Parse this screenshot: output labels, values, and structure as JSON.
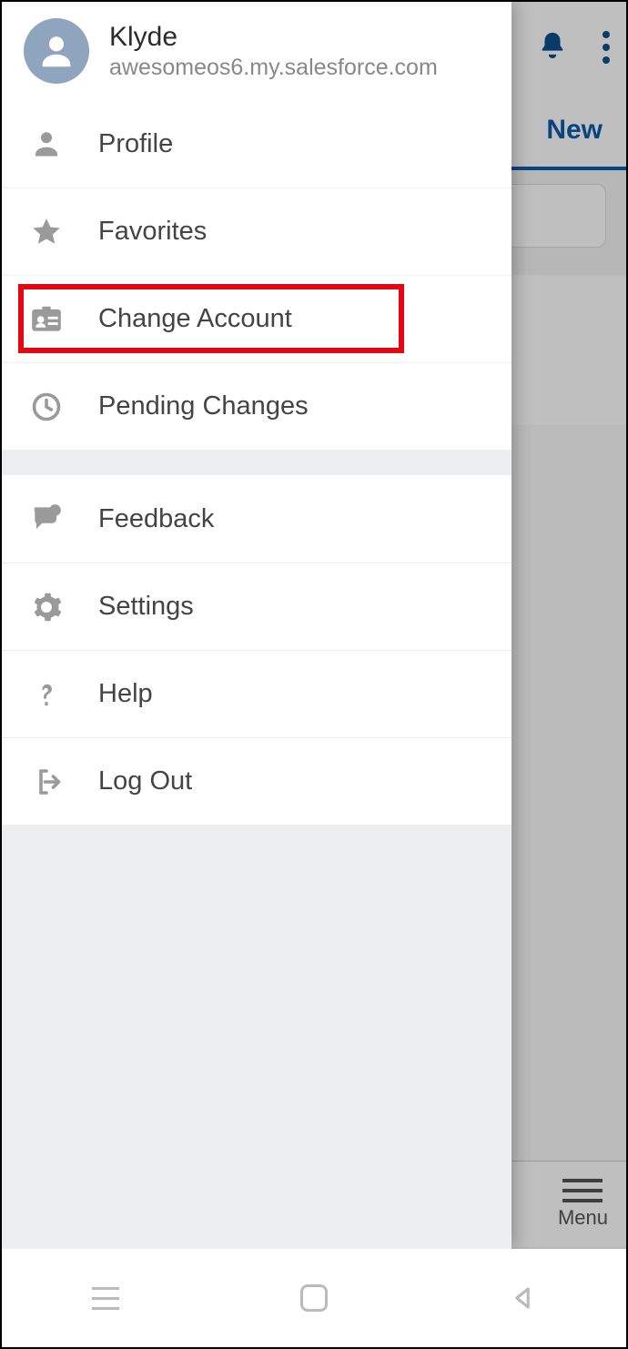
{
  "user": {
    "name": "Klyde",
    "domain": "awesomeos6.my.salesforce.com"
  },
  "menu_group1": {
    "profile": "Profile",
    "favorites": "Favorites",
    "change_account": "Change Account",
    "pending_changes": "Pending Changes"
  },
  "menu_group2": {
    "feedback": "Feedback",
    "settings": "Settings",
    "help": "Help",
    "logout": "Log Out"
  },
  "backdrop": {
    "tab_new": "New",
    "bottom_menu": "Menu"
  }
}
